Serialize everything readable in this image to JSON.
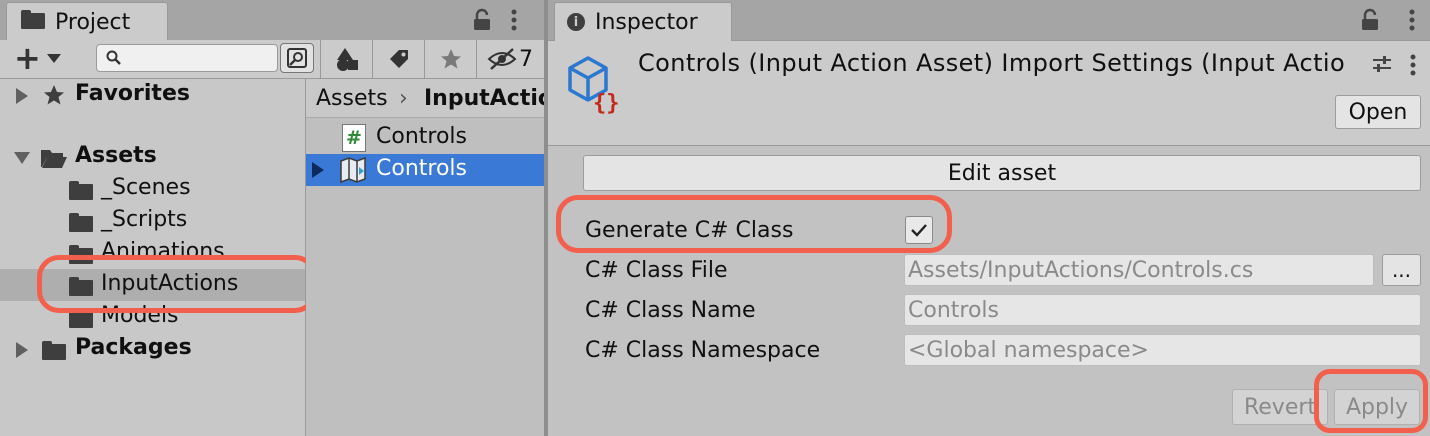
{
  "project": {
    "tab_title": "Project",
    "add_label": "+",
    "search": {
      "placeholder": "",
      "value": ""
    },
    "hidden_count": "7",
    "tree": {
      "favorites": "Favorites",
      "assets": "Assets",
      "folders": [
        "_Scenes",
        "_Scripts",
        "Animations",
        "InputActions",
        "Models"
      ],
      "packages": "Packages"
    },
    "breadcrumb": {
      "root": "Assets",
      "current": "InputActio"
    },
    "files": [
      {
        "name": "Controls",
        "icon": "csharp-script-icon",
        "selected": false
      },
      {
        "name": "Controls",
        "icon": "input-actions-asset-icon",
        "selected": true
      }
    ]
  },
  "inspector": {
    "tab_title": "Inspector",
    "header_title": "Controls (Input Action Asset) Import Settings (Input Actio",
    "open_label": "Open",
    "edit_asset_label": "Edit asset",
    "generate_label": "Generate C# Class",
    "generate_checked": true,
    "class_file": {
      "label": "C# Class File",
      "value": "Assets/InputActions/Controls.cs",
      "browse": "..."
    },
    "class_name": {
      "label": "C# Class Name",
      "value": "Controls"
    },
    "class_namespace": {
      "label": "C# Class Namespace",
      "value": "<Global namespace>"
    },
    "revert_label": "Revert",
    "apply_label": "Apply"
  },
  "colors": {
    "highlight": "#f2604d",
    "selection": "#3a79d6",
    "panel": "#c2c2c2"
  }
}
